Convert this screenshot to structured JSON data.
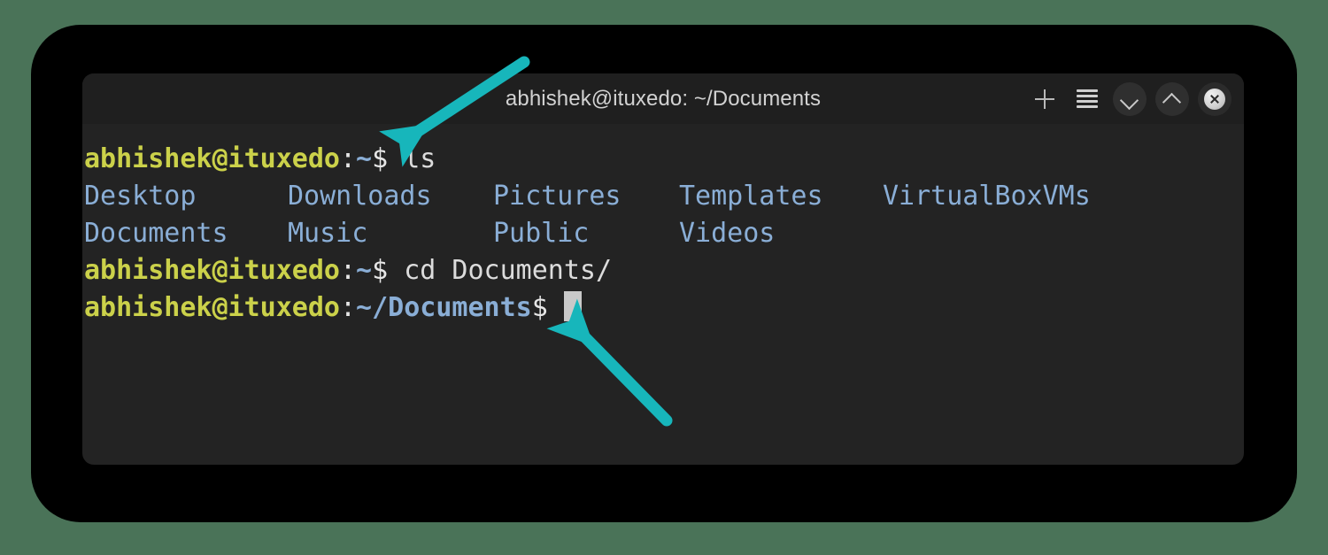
{
  "window": {
    "title": "abhishek@ituxedo: ~/Documents",
    "controls": {
      "new_tab": "+",
      "menu": "menu",
      "minimize": "minimize",
      "maximize": "maximize",
      "close": "close"
    }
  },
  "terminal": {
    "prompt_user": "abhishek@ituxedo",
    "colon": ":",
    "path_home": "~",
    "path_documents": "~/Documents",
    "dollar": "$",
    "line1_command": " ls",
    "line4_command": " cd Documents/",
    "ls_output": {
      "row1": [
        "Desktop",
        "Downloads",
        "Pictures",
        "Templates",
        "VirtualBoxVMs"
      ],
      "row2": [
        "Documents",
        "Music",
        "Public",
        "Videos"
      ]
    },
    "cursor": "block"
  },
  "annotations": {
    "arrow1_label": "arrow-pointing-to-home-prompt",
    "arrow2_label": "arrow-pointing-to-documents-prompt",
    "arrow_color": "#17b6bb"
  },
  "colors": {
    "desktop_background": "#4a7358",
    "frame": "#000000",
    "terminal_background": "#232323",
    "titlebar_background": "#1f1f1f",
    "prompt_user_color": "#cbd14a",
    "path_color": "#8aaed6",
    "command_color": "#dcdcdc",
    "title_color": "#d2d2d2",
    "cursor_color": "#c9c9c9"
  }
}
